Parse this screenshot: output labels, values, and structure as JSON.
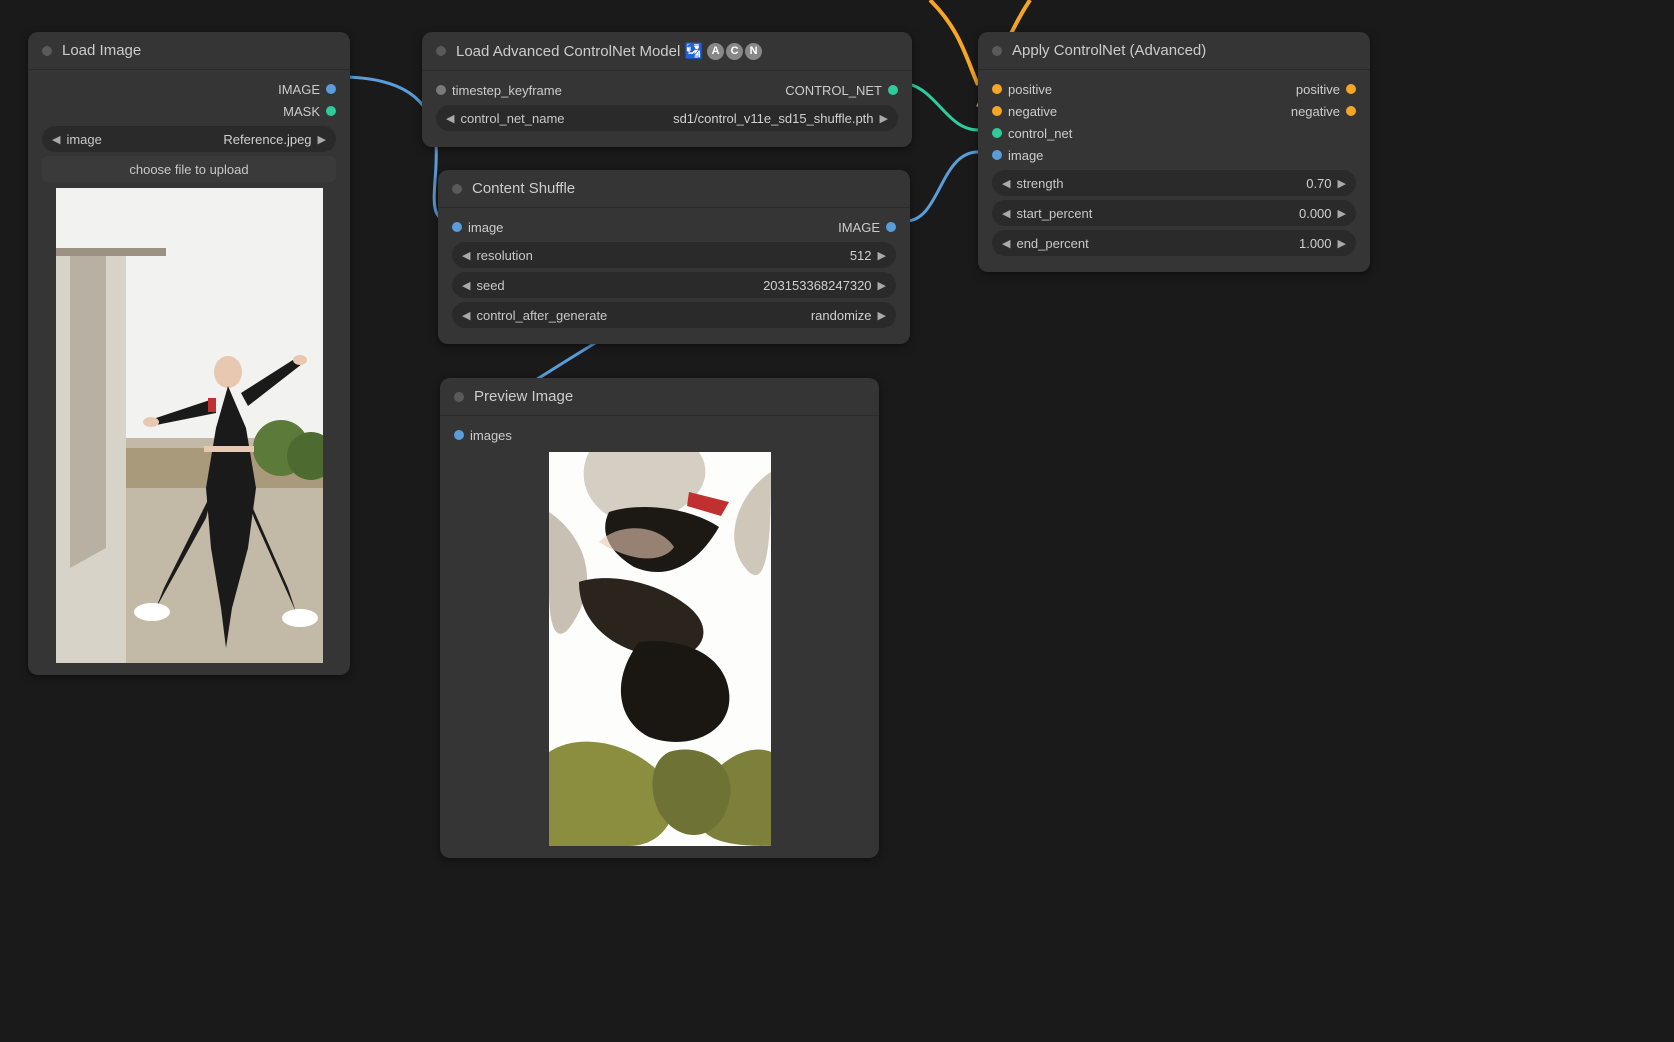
{
  "nodes": {
    "load_image": {
      "title": "Load Image",
      "outputs": {
        "image": "IMAGE",
        "mask": "MASK"
      },
      "widgets": {
        "image_label": "image",
        "image_value": "Reference.jpeg",
        "upload_label": "choose file to upload"
      }
    },
    "load_controlnet": {
      "title": "Load Advanced ControlNet Model 🛂",
      "badges": [
        "A",
        "C",
        "N"
      ],
      "inputs": {
        "timestep_keyframe": "timestep_keyframe"
      },
      "outputs": {
        "control_net": "CONTROL_NET"
      },
      "widgets": {
        "name_label": "control_net_name",
        "name_value": "sd1/control_v11e_sd15_shuffle.pth"
      }
    },
    "content_shuffle": {
      "title": "Content Shuffle",
      "inputs": {
        "image": "image"
      },
      "outputs": {
        "image": "IMAGE"
      },
      "widgets": {
        "resolution_label": "resolution",
        "resolution_value": "512",
        "seed_label": "seed",
        "seed_value": "203153368247320",
        "control_after_label": "control_after_generate",
        "control_after_value": "randomize"
      }
    },
    "preview_image": {
      "title": "Preview Image",
      "inputs": {
        "images": "images"
      }
    },
    "apply_controlnet": {
      "title": "Apply ControlNet (Advanced)",
      "inputs": {
        "positive": "positive",
        "negative": "negative",
        "control_net": "control_net",
        "image": "image"
      },
      "outputs": {
        "positive": "positive",
        "negative": "negative"
      },
      "widgets": {
        "strength_label": "strength",
        "strength_value": "0.70",
        "start_label": "start_percent",
        "start_value": "0.000",
        "end_label": "end_percent",
        "end_value": "1.000"
      }
    }
  }
}
